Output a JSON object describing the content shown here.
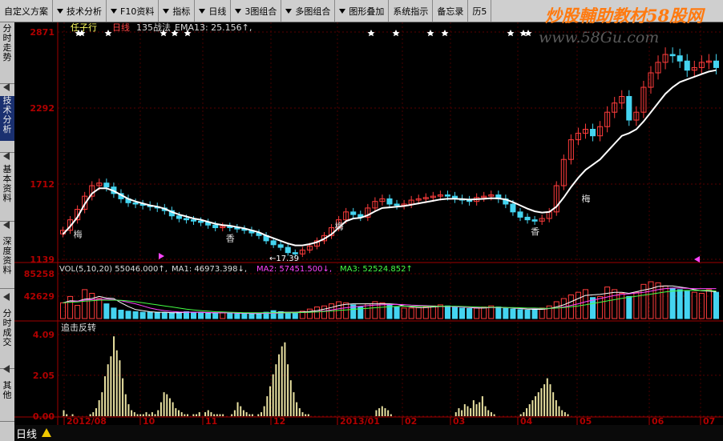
{
  "toolbar": {
    "items": [
      {
        "label": "自定义方案",
        "has_dropdown": false
      },
      {
        "label": "技术分析",
        "has_dropdown": true
      },
      {
        "label": "F10资料",
        "has_dropdown": true
      },
      {
        "label": "指标",
        "has_dropdown": true
      },
      {
        "label": "日线",
        "has_dropdown": true
      },
      {
        "label": "3图组合",
        "has_dropdown": true
      },
      {
        "label": "多图组合",
        "has_dropdown": true
      },
      {
        "label": "图形叠加",
        "has_dropdown": true
      },
      {
        "label": "系统指示",
        "has_dropdown": false
      },
      {
        "label": "备忘录",
        "has_dropdown": false
      },
      {
        "label": "历5",
        "has_dropdown": false
      }
    ]
  },
  "watermark": {
    "text": "炒股輔助教材58股网",
    "url": "www.58Gu.com"
  },
  "sidebar": {
    "tabs": [
      {
        "label": "分时走势",
        "active": false
      },
      {
        "label": "技术分析",
        "active": true
      },
      {
        "label": "基本资料",
        "active": false
      },
      {
        "label": "深度资料",
        "active": false
      },
      {
        "label": "分时成交",
        "active": false
      },
      {
        "label": "其他",
        "active": false
      }
    ]
  },
  "price_panel": {
    "stock_name": "任子行",
    "period": "日线",
    "strategy": "135战法",
    "indicator": "EMA13: 25.156↑,",
    "low_label": "←17.39",
    "markers": [
      "梅",
      "香",
      "梅",
      "香",
      "梅"
    ]
  },
  "volume_panel": {
    "header": "VOL(5,10,20) 55046.000↑,",
    "ma1": "MA1: 46973.398↓,",
    "ma2": "MA2: 57451.500↓,",
    "ma3": "MA3: 52524.852↑"
  },
  "indicator_panel": {
    "title": "追击反转"
  },
  "bottom_bar": {
    "period_tab": "日线"
  },
  "colors": {
    "up": "#ff3c3c",
    "down": "#44d4f0",
    "ema": "#ffffff",
    "axis": "#b00000",
    "ma1": "#ffffff",
    "ma2": "#ff44ff",
    "ma3": "#44ff44",
    "osc": "#e8e0a0",
    "accent": "#ffff00"
  },
  "chart_data": [
    {
      "type": "candlestick",
      "title": "",
      "x_ticks": [
        "2012/08",
        "10",
        "11",
        "12",
        "2013/01",
        "02",
        "03",
        "04",
        "05",
        "06",
        "07"
      ],
      "y_ticks": [
        1139,
        1712,
        2292,
        2871
      ],
      "ylim": [
        1139,
        2871
      ],
      "closes": [
        1360,
        1440,
        1520,
        1620,
        1700,
        1720,
        1690,
        1640,
        1600,
        1570,
        1560,
        1550,
        1540,
        1530,
        1510,
        1470,
        1450,
        1440,
        1430,
        1420,
        1400,
        1380,
        1390,
        1380,
        1370,
        1360,
        1340,
        1320,
        1280,
        1250,
        1230,
        1190,
        1180,
        1210,
        1240,
        1280,
        1320,
        1380,
        1440,
        1500,
        1480,
        1460,
        1530,
        1580,
        1600,
        1560,
        1550,
        1560,
        1590,
        1600,
        1610,
        1620,
        1630,
        1620,
        1600,
        1590,
        1580,
        1610,
        1620,
        1630,
        1600,
        1560,
        1500,
        1460,
        1440,
        1430,
        1450,
        1500,
        1700,
        1900,
        2050,
        2100,
        2130,
        2080,
        2150,
        2260,
        2330,
        2380,
        2200,
        2260,
        2450,
        2560,
        2640,
        2700,
        2690,
        2650,
        2580,
        2600,
        2640,
        2650,
        2600
      ],
      "series": [
        {
          "name": "EMA13",
          "values": [
            1330,
            1390,
            1460,
            1560,
            1640,
            1680,
            1680,
            1660,
            1630,
            1600,
            1580,
            1565,
            1550,
            1540,
            1525,
            1500,
            1480,
            1465,
            1450,
            1440,
            1425,
            1410,
            1400,
            1395,
            1385,
            1375,
            1360,
            1345,
            1320,
            1300,
            1280,
            1260,
            1245,
            1245,
            1255,
            1270,
            1295,
            1330,
            1380,
            1430,
            1450,
            1455,
            1475,
            1505,
            1530,
            1535,
            1540,
            1545,
            1555,
            1565,
            1575,
            1585,
            1595,
            1600,
            1600,
            1598,
            1594,
            1597,
            1600,
            1605,
            1603,
            1595,
            1575,
            1550,
            1525,
            1505,
            1495,
            1500,
            1540,
            1610,
            1690,
            1760,
            1820,
            1860,
            1900,
            1960,
            2020,
            2080,
            2100,
            2130,
            2190,
            2260,
            2330,
            2400,
            2450,
            2490,
            2510,
            2530,
            2550,
            2570,
            2580
          ]
        }
      ]
    },
    {
      "type": "bar",
      "title": "VOL(5,10,20)",
      "y_ticks": [
        0,
        42629,
        85258
      ],
      "ylim": [
        0,
        85258
      ],
      "values": [
        30000,
        42000,
        25000,
        55000,
        48000,
        38000,
        28000,
        20000,
        16000,
        14000,
        13000,
        12000,
        12000,
        11000,
        11000,
        11000,
        12000,
        13000,
        12000,
        11000,
        10000,
        10000,
        11000,
        10000,
        9000,
        9500,
        9000,
        10000,
        12000,
        15000,
        13000,
        10000,
        11000,
        14000,
        18000,
        22000,
        24000,
        28000,
        32000,
        30000,
        26000,
        22000,
        28000,
        32000,
        30000,
        26000,
        22000,
        20000,
        20000,
        21000,
        22000,
        24000,
        26000,
        24000,
        22000,
        20000,
        19000,
        20000,
        22000,
        24000,
        22000,
        20000,
        18000,
        17000,
        16000,
        18000,
        20000,
        24000,
        32000,
        38000,
        45000,
        50000,
        55000,
        40000,
        42000,
        60000,
        55000,
        48000,
        42000,
        50000,
        65000,
        70000,
        68000,
        62000,
        58000,
        55000,
        52000,
        50000,
        48000,
        55000,
        50000
      ],
      "series": [
        {
          "name": "MA1",
          "values": [
            30000,
            34000,
            33000,
            37000,
            38000,
            42000,
            39000,
            38000,
            30000,
            23000,
            17000,
            15000,
            13000,
            12000,
            12000,
            11000,
            11000,
            12000,
            12000,
            12000,
            11000,
            11000,
            11000,
            11000,
            10000,
            10000,
            9500,
            9500,
            10000,
            11000,
            12000,
            12000,
            12000,
            12500,
            13500,
            15000,
            18000,
            21000,
            25000,
            27000,
            28000,
            28000,
            28000,
            28000,
            28000,
            28000,
            27000,
            24000,
            22000,
            21000,
            21000,
            22000,
            23000,
            23000,
            23000,
            22000,
            21000,
            20000,
            20000,
            21000,
            21000,
            21000,
            20000,
            19000,
            18000,
            17500,
            17500,
            19000,
            22000,
            26000,
            32000,
            38000,
            44000,
            45000,
            46000,
            48000,
            50000,
            50000,
            48000,
            51000,
            54000,
            57000,
            61000,
            62000,
            62000,
            60000,
            58000,
            55000,
            53000,
            52000,
            51000
          ]
        },
        {
          "name": "MA2",
          "values": [
            30000,
            32000,
            33000,
            35000,
            36000,
            37000,
            37000,
            36000,
            34000,
            31000,
            28000,
            24000,
            20000,
            17000,
            15000,
            13500,
            12500,
            12000,
            12000,
            12000,
            11500,
            11000,
            11000,
            11000,
            10500,
            10500,
            10000,
            10000,
            10000,
            10000,
            10500,
            11000,
            11000,
            11500,
            12000,
            13000,
            14500,
            16500,
            18500,
            20500,
            22000,
            23500,
            24500,
            25500,
            26000,
            26500,
            27000,
            26500,
            25500,
            25000,
            24500,
            24000,
            23500,
            23000,
            22500,
            22000,
            21500,
            21000,
            21000,
            21000,
            21000,
            20500,
            20500,
            20000,
            19500,
            19000,
            19000,
            19000,
            20000,
            22000,
            25000,
            28000,
            32000,
            35000,
            38000,
            41000,
            44000,
            46000,
            47000,
            48500,
            50000,
            52000,
            55000,
            57000,
            58000,
            58000,
            57500,
            57000,
            57000,
            57000,
            57000
          ]
        },
        {
          "name": "MA3",
          "values": [
            30000,
            31000,
            31500,
            33000,
            34000,
            35000,
            35000,
            35000,
            34500,
            33500,
            32000,
            30000,
            28000,
            26000,
            24000,
            22000,
            20000,
            18000,
            16500,
            15000,
            14000,
            13000,
            12500,
            12000,
            11500,
            11000,
            11000,
            11000,
            11000,
            11000,
            11000,
            11000,
            11000,
            11500,
            12000,
            12500,
            13500,
            14500,
            15500,
            16500,
            17500,
            18500,
            19500,
            20500,
            21500,
            22500,
            23000,
            23500,
            23500,
            23500,
            23500,
            23500,
            23500,
            23500,
            23500,
            23000,
            22500,
            22000,
            21500,
            21500,
            21500,
            21000,
            21000,
            20500,
            20000,
            20000,
            19500,
            19500,
            20000,
            21000,
            22500,
            24000,
            26000,
            28500,
            31000,
            33500,
            36000,
            38500,
            40500,
            42500,
            44500,
            46500,
            48500,
            50500,
            52000,
            53000,
            53500,
            53500,
            53500,
            53500,
            52500
          ]
        }
      ]
    },
    {
      "type": "bar",
      "title": "追击反转",
      "y_ticks": [
        0.0,
        2.05,
        4.09
      ],
      "ylim": [
        0,
        4.09
      ],
      "values": [
        0.0,
        0.3,
        0.1,
        0.0,
        0.1,
        0.0,
        0.0,
        0.0,
        0.0,
        0.0,
        0.1,
        0.2,
        0.4,
        0.8,
        1.2,
        2.0,
        2.6,
        3.0,
        4.0,
        3.3,
        2.8,
        1.9,
        1.1,
        0.6,
        0.3,
        0.2,
        0.1,
        0.1,
        0.1,
        0.2,
        0.1,
        0.2,
        0.1,
        0.3,
        0.7,
        1.2,
        1.1,
        0.9,
        0.7,
        0.4,
        0.3,
        0.2,
        0.1,
        0.1,
        0.0,
        0.1,
        0.1,
        0.2,
        0.0,
        0.2,
        0.3,
        0.2,
        0.1,
        0.1,
        0.1,
        0.1,
        0.0,
        0.0,
        0.1,
        0.3,
        0.7,
        0.5,
        0.3,
        0.2,
        0.1,
        0.1,
        0.0,
        0.1,
        0.2,
        0.5,
        1.0,
        1.5,
        2.1,
        2.6,
        3.1,
        3.5,
        3.7,
        2.6,
        1.8,
        1.2,
        0.7,
        0.4,
        0.2,
        0.1,
        0.1,
        0.0,
        0.0,
        0.0,
        0.0,
        0.0,
        0.0,
        0.0,
        0.0,
        0.0,
        0.0,
        0.0,
        0.0,
        0.0,
        0.0,
        0.0,
        0.0,
        0.0,
        0.0,
        0.0,
        0.0,
        0.0,
        0.0,
        0.3,
        0.4,
        0.5,
        0.4,
        0.3,
        0.1,
        0.0,
        0.0,
        0.0,
        0.0,
        0.0,
        0.0,
        0.0,
        0.0,
        0.0,
        0.0,
        0.0,
        0.0,
        0.0,
        0.0,
        0.0,
        0.0,
        0.0,
        0.0,
        0.0,
        0.0,
        0.0,
        0.2,
        0.4,
        0.3,
        0.6,
        0.5,
        0.4,
        0.8,
        0.6,
        0.7,
        1.0,
        0.5,
        0.3,
        0.2,
        0.1,
        0.0,
        0.0,
        0.0,
        0.0,
        0.0,
        0.0,
        0.0,
        0.0,
        0.1,
        0.2,
        0.4,
        0.6,
        0.8,
        1.0,
        1.2,
        1.4,
        1.6,
        1.9,
        1.6,
        1.2,
        0.8,
        0.5,
        0.3,
        0.2,
        0.1,
        0.0,
        0.0,
        0.0,
        0.0,
        0.0,
        0.0,
        0.0,
        0.0,
        0.0,
        0.0,
        0.0,
        0.0,
        0.0,
        0.0,
        0.0,
        0.0,
        0.0,
        0.0,
        0.0,
        0.0,
        0.0,
        0.0,
        0.0,
        0.0,
        0.0,
        0.0,
        0.0,
        0.0,
        0.0,
        0.0,
        0.0,
        0.0,
        0.0,
        0.0,
        0.0,
        0.0,
        0.0,
        0.0,
        0.0,
        0.0,
        0.0,
        0.0,
        0.0,
        0.0,
        0.0,
        0.0,
        0.0,
        0.0,
        0.0,
        0.0,
        0.0
      ]
    }
  ]
}
